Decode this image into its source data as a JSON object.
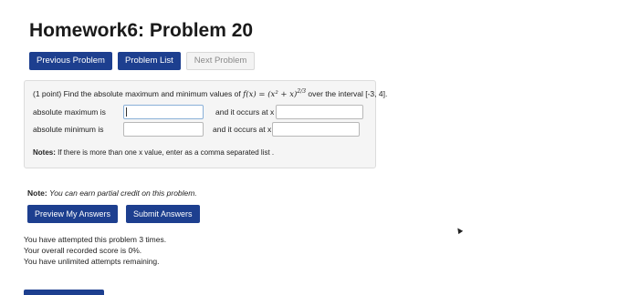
{
  "page": {
    "title": "Homework6: Problem 20"
  },
  "nav": {
    "previous_label": "Previous Problem",
    "list_label": "Problem List",
    "next_label": "Next Problem"
  },
  "problem": {
    "points": "(1 point)",
    "prompt_before": "Find the absolute maximum and minimum values of",
    "function": "f(x) = (x² + x)",
    "exponent": "2/3",
    "prompt_after": "over the interval [-3, 4].",
    "max_label": "absolute maximum is",
    "min_label": "absolute minimum is",
    "occurs_label": "and it occurs at x =",
    "max_value": "",
    "min_value": "",
    "max_x_value": "",
    "min_x_value": "",
    "notes_label": "Notes:",
    "notes_text": "If there is more than one x value, enter as a comma separated list ."
  },
  "credit": {
    "label": "Note:",
    "text": "You can earn partial credit on this problem."
  },
  "actions": {
    "preview_label": "Preview My Answers",
    "submit_label": "Submit Answers"
  },
  "status": {
    "attempts": "You have attempted this problem 3 times.",
    "score": "Your overall recorded score is 0%.",
    "remaining": "You have unlimited attempts remaining."
  }
}
